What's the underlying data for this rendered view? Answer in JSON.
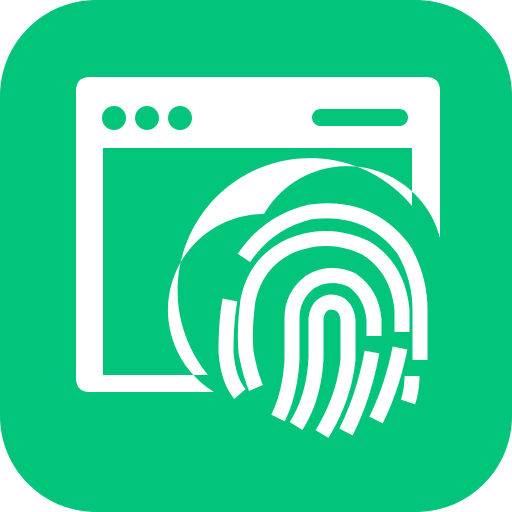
{
  "icon": {
    "semantic": "browser-fingerprint-icon",
    "colors": {
      "background": "#03C47B",
      "foreground": "#FFFFFF"
    },
    "elements": [
      "rounded-square-background",
      "browser-window-icon",
      "window-control-dots-icon",
      "address-bar-icon",
      "fingerprint-icon"
    ]
  }
}
